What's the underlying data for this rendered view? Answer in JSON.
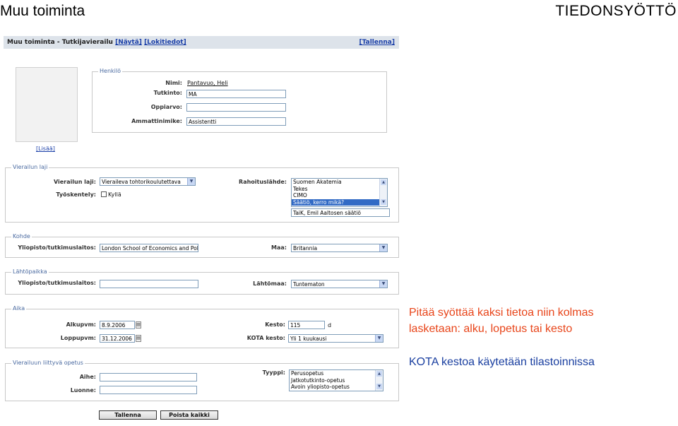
{
  "slide": {
    "title": "Muu toiminta",
    "right_title": "TIEDONSYÖTTÖ"
  },
  "app": {
    "header_title": "Muu toiminta - Tutkijavierailu",
    "show_link": "[Näytä]",
    "log_link": "[Lokitiedot]",
    "save_link": "[Tallenna]",
    "add_link": "[Lisää]"
  },
  "henkilo": {
    "legend": "Henkilö",
    "nimi_label": "Nimi:",
    "nimi_value": "Pantavuo, Heli",
    "tutkinto_label": "Tutkinto:",
    "tutkinto_value": "MA",
    "oppiarvo_label": "Oppiarvo:",
    "oppiarvo_value": "",
    "ammatti_label": "Ammattinimike:",
    "ammatti_value": "Assistentti"
  },
  "vierailun_laji": {
    "legend": "Vierailun laji",
    "laji_label": "Vierailun laji:",
    "laji_value": "Vieraileva tohtorikoulutettava",
    "tyoskentely_label": "Työskentely:",
    "kylla_label": "Kyllä",
    "rahoitus_label": "Rahoituslähde:",
    "rahoitus_options": [
      "Suomen Akatemia",
      "Tekes",
      "CIMO",
      "Säätiö, kerro mikä?"
    ],
    "rahoitus_selected": 3,
    "rahoitus_text": "TaiK, Emil Aaltosen säätiö"
  },
  "kohde": {
    "legend": "Kohde",
    "yliopisto_label": "Yliopisto/tutkimuslaitos:",
    "yliopisto_value": "London School of Economics and Politi",
    "maa_label": "Maa:",
    "maa_value": "Britannia"
  },
  "lahtopaikka": {
    "legend": "Lähtöpaikka",
    "yliopisto_label": "Yliopisto/tutkimuslaitos:",
    "yliopisto_value": "",
    "lahtomaa_label": "Lähtömaa:",
    "lahtomaa_value": "Tuntematon"
  },
  "aika": {
    "legend": "Aika",
    "alku_label": "Alkupvm:",
    "alku_value": "8.9.2006",
    "loppu_label": "Loppupvm:",
    "loppu_value": "31.12.2006",
    "kesto_label": "Kesto:",
    "kesto_value": "115",
    "kesto_unit": "d",
    "kota_label": "KOTA kesto:",
    "kota_value": "Yli 1 kuukausi"
  },
  "opetus": {
    "legend": "Vierailuun liittyvä opetus",
    "aihe_label": "Aihe:",
    "aihe_value": "",
    "luonne_label": "Luonne:",
    "luonne_value": "",
    "tyyppi_label": "Tyyppi:",
    "tyyppi_options": [
      "Perusopetus",
      "Jatkotutkinto-opetus",
      "Avoin yliopisto-opetus"
    ]
  },
  "buttons": {
    "save": "Tallenna",
    "delete_all": "Poista kaikki"
  },
  "notes": {
    "line1": "Pitää syöttää kaksi tietoa niin kolmas",
    "line2": "lasketaan: alku, lopetus tai kesto",
    "line3": "KOTA kestoa käytetään tilastoinnissa"
  },
  "colors": {
    "note_red": "#e8451a",
    "note_blue": "#1a3fa0",
    "link": "#1a3fa8",
    "selected": "#316ac5"
  }
}
